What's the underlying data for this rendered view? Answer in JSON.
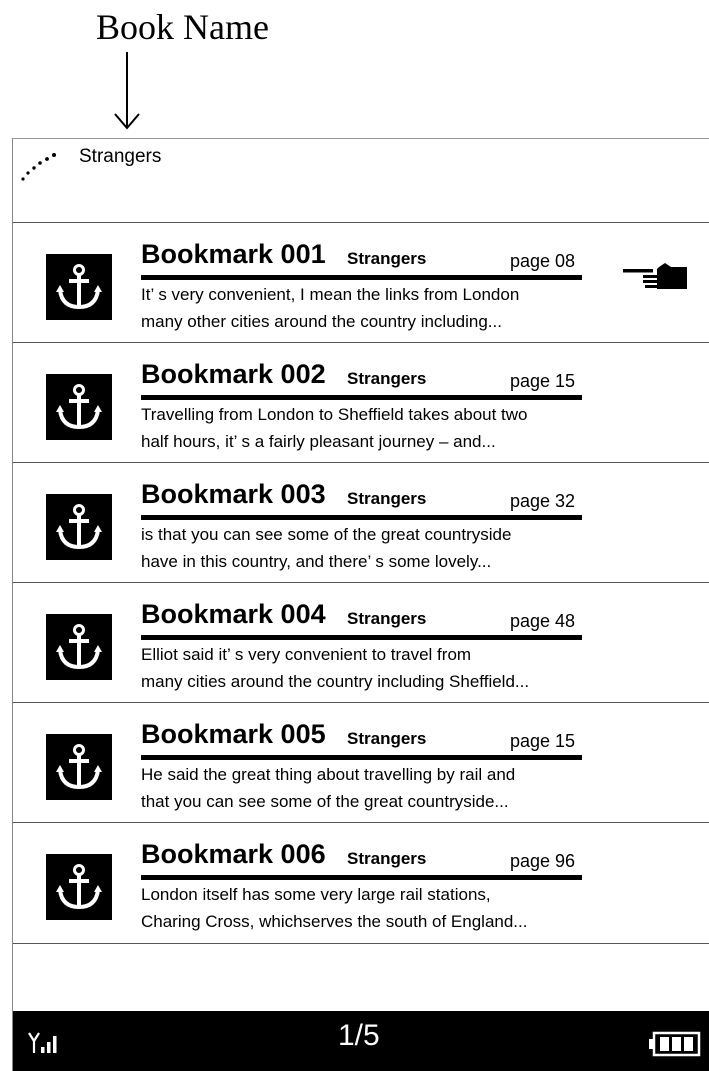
{
  "annotation": {
    "label": "Book Name",
    "arrow_icon": "down-arrow-icon"
  },
  "header": {
    "book_title": "Strangers",
    "status_icon": "loading-dots-icon"
  },
  "bookmarks": [
    {
      "title": "Bookmark 001",
      "book": "Strangers",
      "page": "page 08",
      "line1": "It’ s very convenient, I mean the links from London",
      "line2": "many other cities around the country including...",
      "selected": true
    },
    {
      "title": "Bookmark 002",
      "book": "Strangers",
      "page": "page 15",
      "line1": "Travelling from London to Sheffield takes about two",
      "line2": "half hours, it’ s a fairly pleasant journey – and...",
      "selected": false
    },
    {
      "title": "Bookmark 003",
      "book": "Strangers",
      "page": "page 32",
      "line1": "is that you can see some of the great countryside",
      "line2": "have in this country, and there’ s some lovely...",
      "selected": false
    },
    {
      "title": "Bookmark 004",
      "book": "Strangers",
      "page": "page 48",
      "line1": "Elliot said it’ s very convenient to travel from",
      "line2": "many cities around the country including Sheffield...",
      "selected": false
    },
    {
      "title": "Bookmark 005",
      "book": "Strangers",
      "page": "page 15",
      "line1": "He said the great thing about travelling by rail and",
      "line2": "that you can see some of the great countryside...",
      "selected": false
    },
    {
      "title": "Bookmark 006",
      "book": "Strangers",
      "page": "page 96",
      "line1": "London itself has some very large rail stations,",
      "line2": "Charing Cross, whichserves the south of England...",
      "selected": false
    }
  ],
  "statusbar": {
    "page_indicator": "1/5",
    "signal_icon": "signal-icon",
    "battery_icon": "battery-icon"
  }
}
